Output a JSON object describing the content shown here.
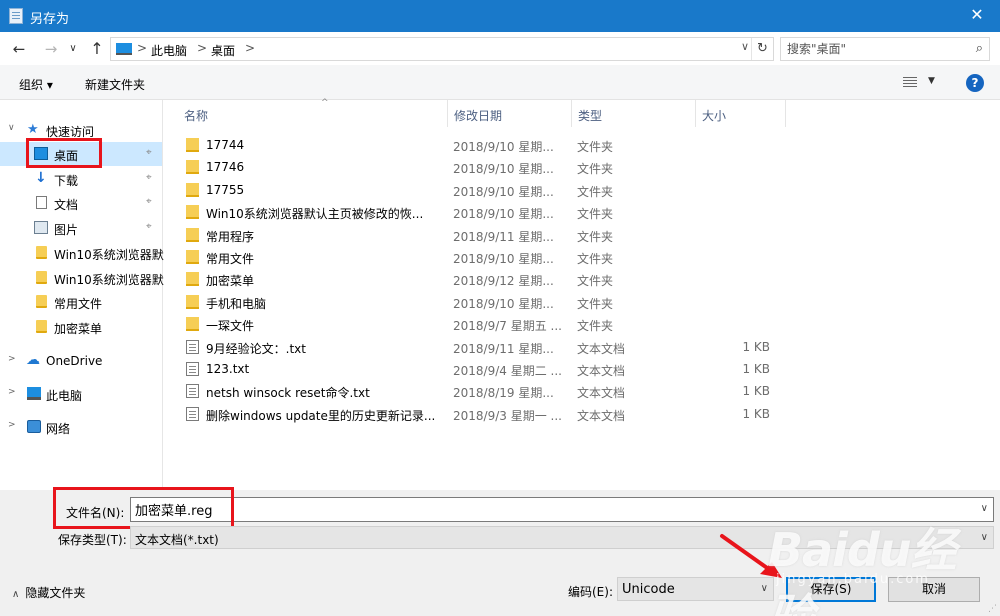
{
  "window": {
    "title": "另存为",
    "close_glyph": "✕"
  },
  "nav": {
    "back": "←",
    "forward": "→",
    "dropdown": "∨",
    "up": "↑"
  },
  "address": {
    "crumbs": [
      "此电脑",
      "桌面"
    ],
    "separator": ">",
    "dropdown": "∨",
    "refresh": "↻"
  },
  "search": {
    "placeholder": "搜索\"桌面\"",
    "icon": "search-icon"
  },
  "toolbar": {
    "organize": "组织 ▾",
    "new_folder": "新建文件夹",
    "view_arrow": "▼",
    "help": "?"
  },
  "sidebar": {
    "quick_access": "快速访问",
    "items": [
      {
        "label": "桌面",
        "icon": "desktop-icon",
        "pinned": true,
        "selected": true
      },
      {
        "label": "下载",
        "icon": "download-icon",
        "pinned": true
      },
      {
        "label": "文档",
        "icon": "document-icon",
        "pinned": true
      },
      {
        "label": "图片",
        "icon": "picture-icon",
        "pinned": true
      },
      {
        "label": "Win10系统浏览器默",
        "icon": "folder-icon"
      },
      {
        "label": "Win10系统浏览器默",
        "icon": "folder-icon"
      },
      {
        "label": "常用文件",
        "icon": "folder-icon"
      },
      {
        "label": "加密菜单",
        "icon": "folder-icon"
      }
    ],
    "onedrive": "OneDrive",
    "this_pc": "此电脑",
    "network": "网络",
    "pin_glyph": "📌",
    "expand_glyph": ">",
    "collapse_glyph": "∨"
  },
  "columns": {
    "name": "名称",
    "modified": "修改日期",
    "type": "类型",
    "size": "大小",
    "sort_caret": "^"
  },
  "files": [
    {
      "name": "17744",
      "date": "2018/9/10 星期...",
      "type": "文件夹",
      "size": "",
      "kind": "folder"
    },
    {
      "name": "17746",
      "date": "2018/9/10 星期...",
      "type": "文件夹",
      "size": "",
      "kind": "folder"
    },
    {
      "name": "17755",
      "date": "2018/9/10 星期...",
      "type": "文件夹",
      "size": "",
      "kind": "folder"
    },
    {
      "name": "Win10系统浏览器默认主页被修改的恢...",
      "date": "2018/9/10 星期...",
      "type": "文件夹",
      "size": "",
      "kind": "folder"
    },
    {
      "name": "常用程序",
      "date": "2018/9/11 星期...",
      "type": "文件夹",
      "size": "",
      "kind": "folder"
    },
    {
      "name": "常用文件",
      "date": "2018/9/10 星期...",
      "type": "文件夹",
      "size": "",
      "kind": "folder"
    },
    {
      "name": "加密菜单",
      "date": "2018/9/12 星期...",
      "type": "文件夹",
      "size": "",
      "kind": "folder"
    },
    {
      "name": "手机和电脑",
      "date": "2018/9/10 星期...",
      "type": "文件夹",
      "size": "",
      "kind": "folder"
    },
    {
      "name": "一琛文件",
      "date": "2018/9/7 星期五 ...",
      "type": "文件夹",
      "size": "",
      "kind": "folder"
    },
    {
      "name": "9月经验论文：.txt",
      "date": "2018/9/11 星期...",
      "type": "文本文档",
      "size": "1 KB",
      "kind": "txt"
    },
    {
      "name": "123.txt",
      "date": "2018/9/4 星期二 ...",
      "type": "文本文档",
      "size": "1 KB",
      "kind": "txt"
    },
    {
      "name": "netsh winsock reset命令.txt",
      "date": "2018/8/19 星期...",
      "type": "文本文档",
      "size": "1 KB",
      "kind": "txt"
    },
    {
      "name": "删除windows update里的历史更新记录...",
      "date": "2018/9/3 星期一 ...",
      "type": "文本文档",
      "size": "1 KB",
      "kind": "txt"
    }
  ],
  "form": {
    "filename_label": "文件名(N):",
    "filename_value": "加密菜单.reg",
    "filetype_label": "保存类型(T):",
    "filetype_value": "文本文档(*.txt)",
    "dropdown": "∨"
  },
  "footer": {
    "hide_folders": "隐藏文件夹",
    "hide_caret": "∧",
    "encoding_label": "编码(E):",
    "encoding_value": "Unicode",
    "save": "保存(S)",
    "cancel": "取消"
  },
  "watermark": {
    "brand": "Baidu经验",
    "sub": "jingyan.baidu.com"
  },
  "colors": {
    "titlebar": "#1979ca",
    "selected": "#cce8ff",
    "highlight": "#e8141b",
    "accent": "#0078d7"
  }
}
